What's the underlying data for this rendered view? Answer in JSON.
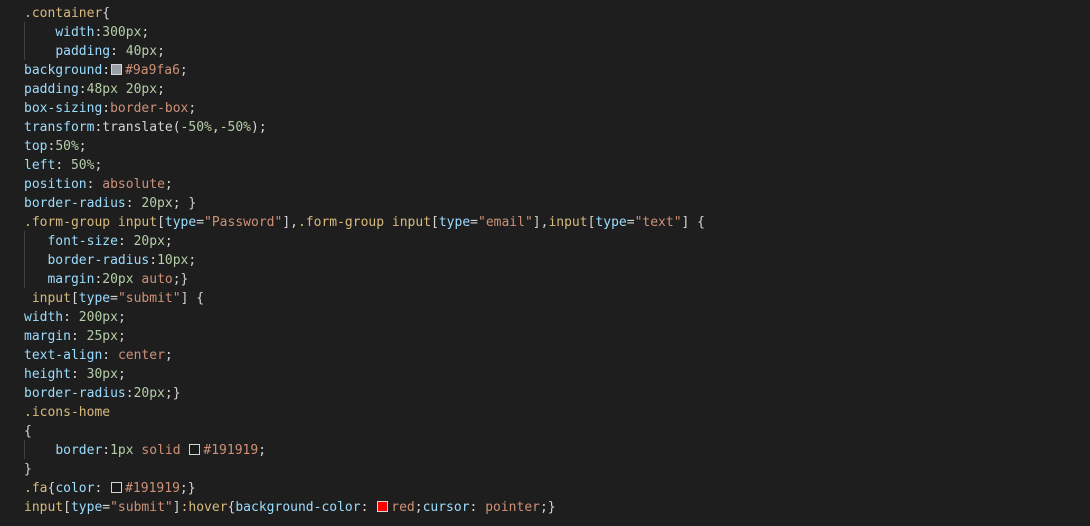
{
  "colors": {
    "background": "#1e1e1e",
    "selector": "#d7ba7d",
    "property": "#9cdcfe",
    "number": "#b5cea8",
    "string": "#ce9178",
    "text": "#d4d4d4",
    "swatch_gray": "#9a9fa6",
    "swatch_dark": "#191919",
    "swatch_red": "#ff0000"
  },
  "lines": [
    [
      {
        "t": ".container",
        "c": "sel"
      },
      {
        "t": "{",
        "c": "punc"
      }
    ],
    [
      {
        "t": "    "
      },
      {
        "t": "width",
        "c": "prop"
      },
      {
        "t": ":"
      },
      {
        "t": "300px",
        "c": "num"
      },
      {
        "t": ";"
      }
    ],
    [
      {
        "t": "    "
      },
      {
        "t": "padding",
        "c": "prop"
      },
      {
        "t": ": "
      },
      {
        "t": "40px",
        "c": "num"
      },
      {
        "t": ";"
      }
    ],
    [
      {
        "t": "background",
        "c": "prop"
      },
      {
        "t": ":"
      },
      {
        "sw": "swatch_gray"
      },
      {
        "t": "#9a9fa6",
        "c": "val"
      },
      {
        "t": ";"
      }
    ],
    [
      {
        "t": "padding",
        "c": "prop"
      },
      {
        "t": ":"
      },
      {
        "t": "48px 20px",
        "c": "num"
      },
      {
        "t": ";"
      }
    ],
    [
      {
        "t": "box-sizing",
        "c": "prop"
      },
      {
        "t": ":"
      },
      {
        "t": "border-box",
        "c": "val"
      },
      {
        "t": ";"
      }
    ],
    [
      {
        "t": "transform",
        "c": "prop"
      },
      {
        "t": ":translate("
      },
      {
        "t": "-50%",
        "c": "num"
      },
      {
        "t": ","
      },
      {
        "t": "-50%",
        "c": "num"
      },
      {
        "t": ");"
      }
    ],
    [
      {
        "t": "top",
        "c": "prop"
      },
      {
        "t": ":"
      },
      {
        "t": "50%",
        "c": "num"
      },
      {
        "t": ";"
      }
    ],
    [
      {
        "t": "left",
        "c": "prop"
      },
      {
        "t": ": "
      },
      {
        "t": "50%",
        "c": "num"
      },
      {
        "t": ";"
      }
    ],
    [
      {
        "t": "position",
        "c": "prop"
      },
      {
        "t": ": "
      },
      {
        "t": "absolute",
        "c": "val"
      },
      {
        "t": ";"
      }
    ],
    [
      {
        "t": "border-radius",
        "c": "prop"
      },
      {
        "t": ": "
      },
      {
        "t": "20px",
        "c": "num"
      },
      {
        "t": "; }"
      }
    ],
    [
      {
        "t": ".form-group input",
        "c": "sel"
      },
      {
        "t": "["
      },
      {
        "t": "type",
        "c": "prop"
      },
      {
        "t": "="
      },
      {
        "t": "\"Password\"",
        "c": "str"
      },
      {
        "t": "],"
      },
      {
        "t": ".form-group input",
        "c": "sel"
      },
      {
        "t": "["
      },
      {
        "t": "type",
        "c": "prop"
      },
      {
        "t": "="
      },
      {
        "t": "\"email\"",
        "c": "str"
      },
      {
        "t": "],"
      },
      {
        "t": "input",
        "c": "sel"
      },
      {
        "t": "["
      },
      {
        "t": "type",
        "c": "prop"
      },
      {
        "t": "="
      },
      {
        "t": "\"text\"",
        "c": "str"
      },
      {
        "t": "] {"
      }
    ],
    [
      {
        "t": "   "
      },
      {
        "t": "font-size",
        "c": "prop"
      },
      {
        "t": ": "
      },
      {
        "t": "20px",
        "c": "num"
      },
      {
        "t": ";"
      }
    ],
    [
      {
        "t": "   "
      },
      {
        "t": "border-radius",
        "c": "prop"
      },
      {
        "t": ":"
      },
      {
        "t": "10px",
        "c": "num"
      },
      {
        "t": ";"
      }
    ],
    [
      {
        "t": "   "
      },
      {
        "t": "margin",
        "c": "prop"
      },
      {
        "t": ":"
      },
      {
        "t": "20px",
        "c": "num"
      },
      {
        "t": " "
      },
      {
        "t": "auto",
        "c": "val"
      },
      {
        "t": ";}"
      }
    ],
    [
      {
        "t": " "
      },
      {
        "t": "input",
        "c": "sel"
      },
      {
        "t": "["
      },
      {
        "t": "type",
        "c": "prop"
      },
      {
        "t": "="
      },
      {
        "t": "\"submit\"",
        "c": "str"
      },
      {
        "t": "] {"
      }
    ],
    [
      {
        "t": "width",
        "c": "prop"
      },
      {
        "t": ": "
      },
      {
        "t": "200px",
        "c": "num"
      },
      {
        "t": ";"
      }
    ],
    [
      {
        "t": "margin",
        "c": "prop"
      },
      {
        "t": ": "
      },
      {
        "t": "25px",
        "c": "num"
      },
      {
        "t": ";"
      }
    ],
    [
      {
        "t": "text-align",
        "c": "prop"
      },
      {
        "t": ": "
      },
      {
        "t": "center",
        "c": "val"
      },
      {
        "t": ";"
      }
    ],
    [
      {
        "t": "height",
        "c": "prop"
      },
      {
        "t": ": "
      },
      {
        "t": "30px",
        "c": "num"
      },
      {
        "t": ";"
      }
    ],
    [
      {
        "t": "border-radius",
        "c": "prop"
      },
      {
        "t": ":"
      },
      {
        "t": "20px",
        "c": "num"
      },
      {
        "t": ";}"
      }
    ],
    [
      {
        "t": ".icons-home",
        "c": "sel"
      }
    ],
    [
      {
        "t": "{"
      }
    ],
    [
      {
        "t": "    "
      },
      {
        "t": "border",
        "c": "prop"
      },
      {
        "t": ":"
      },
      {
        "t": "1px",
        "c": "num"
      },
      {
        "t": " "
      },
      {
        "t": "solid",
        "c": "val"
      },
      {
        "t": " "
      },
      {
        "sw": "swatch_dark"
      },
      {
        "t": "#191919",
        "c": "val"
      },
      {
        "t": ";"
      }
    ],
    [
      {
        "t": "}"
      }
    ],
    [
      {
        "t": ".fa",
        "c": "sel"
      },
      {
        "t": "{"
      },
      {
        "t": "color",
        "c": "prop"
      },
      {
        "t": ": "
      },
      {
        "sw": "swatch_dark"
      },
      {
        "t": "#191919",
        "c": "val"
      },
      {
        "t": ";}"
      }
    ],
    [
      {
        "t": "input",
        "c": "sel"
      },
      {
        "t": "["
      },
      {
        "t": "type",
        "c": "prop"
      },
      {
        "t": "="
      },
      {
        "t": "\"submit\"",
        "c": "str"
      },
      {
        "t": "]"
      },
      {
        "t": ":hover",
        "c": "sel"
      },
      {
        "t": "{"
      },
      {
        "t": "background-color",
        "c": "prop"
      },
      {
        "t": ": "
      },
      {
        "sw": "swatch_red"
      },
      {
        "t": "red",
        "c": "val"
      },
      {
        "t": ";"
      },
      {
        "t": "cursor",
        "c": "prop"
      },
      {
        "t": ": "
      },
      {
        "t": "pointer",
        "c": "val"
      },
      {
        "t": ";}"
      }
    ]
  ]
}
